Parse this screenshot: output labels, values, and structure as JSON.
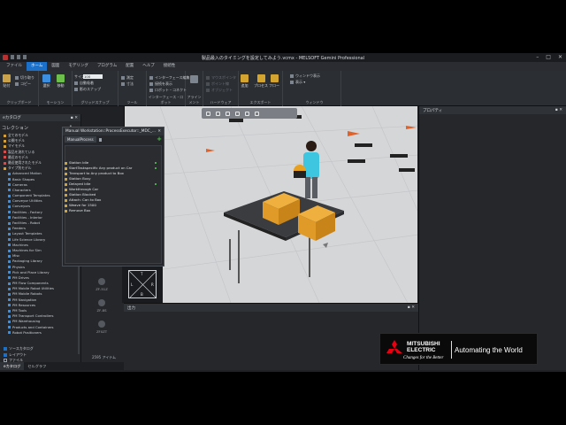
{
  "window": {
    "title": "製品最入のタイミングを設定してみよう.vcmx - MELSOFT Gemini Professional"
  },
  "colors": {
    "accent": "#1c70c8",
    "brand_red": "#e60012",
    "box_orange": "#e6a030",
    "active_green": "#52c252"
  },
  "ribbon_tabs": [
    "ファイル",
    "ホーム",
    "図面",
    "モデリング",
    "プログラム",
    "配置",
    "ヘルプ",
    "接続性"
  ],
  "ribbon_active_tab": "ホーム",
  "ribbon": {
    "clipboard": {
      "paste": "貼付",
      "cut": "切り取り",
      "copy": "コピー",
      "label": "クリップボード"
    },
    "manipulation": {
      "select": "選択",
      "move": "移動",
      "label": "モーション"
    },
    "snap": {
      "snap": "スナップ",
      "size_label": "サイズ",
      "size_value": "100",
      "all": "自動吸着",
      "shadow": "影のスナップ",
      "label": "グリッドスナップ"
    },
    "tools": {
      "measure": "測定",
      "dimension": "寸法",
      "label": "ツール"
    },
    "connect": {
      "interface_edit": "インターフェース編集",
      "show": "接続を表示",
      "robot_connect": "ロボット・コネクト",
      "label": "インターフェース・ロボット"
    },
    "align": {
      "label": "アラインメント"
    },
    "layout": {
      "items": [
        "マウスポインタ",
        "ポイント線",
        "オブジェクト"
      ],
      "label": "ハードウェア"
    },
    "import_export": {
      "import": "追加",
      "process": "プロセス",
      "flow": "フロー",
      "label": "エクスポート"
    },
    "display": {
      "items": [
        "ワークエリアの表示",
        "表示ユーザ",
        "ハイライトにしたアイテム"
      ],
      "label": "ウィンドウ"
    },
    "window": {
      "items": [
        "ウィンドウ表示",
        "表示 ▾"
      ],
      "label": "ウィンドウ"
    }
  },
  "catalog": {
    "header": "eカタログ",
    "section": "コレクション",
    "tree": [
      {
        "label": "全てのモデル",
        "color": "#d0a040",
        "child": false
      },
      {
        "label": "公開モデル",
        "color": "#d0a040",
        "child": false
      },
      {
        "label": "マイモデル",
        "color": "#d0a040",
        "child": false
      },
      {
        "label": "製品を流れている",
        "color": "#d05050",
        "child": false
      },
      {
        "label": "最近のモデル",
        "color": "#d05050",
        "child": false
      },
      {
        "label": "最近使用されたモデル",
        "color": "#d05050",
        "child": false
      },
      {
        "label": "タイプ別モデル",
        "color": "#d0a040",
        "child": false
      },
      {
        "label": "Advanced Motion",
        "color": "#3c8fe0",
        "child": true
      },
      {
        "label": "Basic Shapes",
        "color": "#3c8fe0",
        "child": true
      },
      {
        "label": "Cameras",
        "color": "#3c8fe0",
        "child": true
      },
      {
        "label": "Characters",
        "color": "#3c8fe0",
        "child": true
      },
      {
        "label": "Component Templates",
        "color": "#3c8fe0",
        "child": true
      },
      {
        "label": "Conveyor Utilities",
        "color": "#3c8fe0",
        "child": true
      },
      {
        "label": "Conveyors",
        "color": "#3c8fe0",
        "child": true
      },
      {
        "label": "Facilities - Factory",
        "color": "#3c8fe0",
        "child": true
      },
      {
        "label": "Facilities - Interior",
        "color": "#3c8fe0",
        "child": true
      },
      {
        "label": "Facilities - Robot",
        "color": "#3c8fe0",
        "child": true
      },
      {
        "label": "Feeders",
        "color": "#3c8fe0",
        "child": true
      },
      {
        "label": "Layout Templates",
        "color": "#3c8fe0",
        "child": true
      },
      {
        "label": "Life Science Library",
        "color": "#3c8fe0",
        "child": true
      },
      {
        "label": "Machines",
        "color": "#3c8fe0",
        "child": true
      },
      {
        "label": "Machines for Sim",
        "color": "#3c8fe0",
        "child": true
      },
      {
        "label": "Misc",
        "color": "#3c8fe0",
        "child": true
      },
      {
        "label": "Packaging Library",
        "color": "#3c8fe0",
        "child": true
      },
      {
        "label": "Physics",
        "color": "#3c8fe0",
        "child": true
      },
      {
        "label": "Pick and Place Library",
        "color": "#3c8fe0",
        "child": true
      },
      {
        "label": "PM Drives",
        "color": "#3c8fe0",
        "child": true
      },
      {
        "label": "PM Flow Components",
        "color": "#3c8fe0",
        "child": true
      },
      {
        "label": "PM Mobile Robot Utilities",
        "color": "#3c8fe0",
        "child": true
      },
      {
        "label": "PM Mobile Robots",
        "color": "#3c8fe0",
        "child": true
      },
      {
        "label": "PM Navigation",
        "color": "#3c8fe0",
        "child": true
      },
      {
        "label": "PM Resources",
        "color": "#3c8fe0",
        "child": true
      },
      {
        "label": "PM Tools",
        "color": "#3c8fe0",
        "child": true
      },
      {
        "label": "PM Transport Controllers",
        "color": "#3c8fe0",
        "child": true
      },
      {
        "label": "PM Warehousing",
        "color": "#3c8fe0",
        "child": true
      },
      {
        "label": "Products and Containers",
        "color": "#3c8fe0",
        "child": true
      },
      {
        "label": "Robot Positioners",
        "color": "#3c8fe0",
        "child": true
      }
    ],
    "checks": [
      {
        "label": "ソースカタログ",
        "on": true
      },
      {
        "label": "レイアウト",
        "on": true
      },
      {
        "label": "ファイル",
        "on": false
      }
    ],
    "previews": [
      "ZF-51Z",
      "ZF-8S",
      "ZF0ZT"
    ],
    "item_count": "2595 アイテム"
  },
  "bottom_tabs": [
    "eカタログ",
    "セルグラフ"
  ],
  "manual_window": {
    "title": "Manual Workstation::ProcessExecutor::_MDC_...",
    "tab": "ManualProcess",
    "steps": [
      {
        "label": "Station Idle",
        "flag": true
      },
      {
        "label": "StartTaskspecific Any product on Car",
        "flag": true
      },
      {
        "label": "Transport to Any product to Box",
        "flag": false
      },
      {
        "label": "Station Busy",
        "flag": false
      },
      {
        "label": "Delayed Idle",
        "flag": true
      },
      {
        "label": "Workthrough Car",
        "flag": false
      },
      {
        "label": "Station Blocked",
        "flag": false
      },
      {
        "label": "Attach: Can to Box",
        "flag": false
      },
      {
        "label": "Weave for 1500",
        "flag": false
      },
      {
        "label": "Remove Box",
        "flag": false
      }
    ]
  },
  "properties": {
    "header": "プロパティ"
  },
  "output": {
    "header": "出力"
  },
  "navcube": {
    "top": "T",
    "left": "L",
    "bottom": "B",
    "right": "R"
  },
  "brand": {
    "name_line1": "MITSUBISHI",
    "name_line2": "ELECTRIC",
    "slogan": "Changes for the Better",
    "tagline": "Automating the World"
  }
}
